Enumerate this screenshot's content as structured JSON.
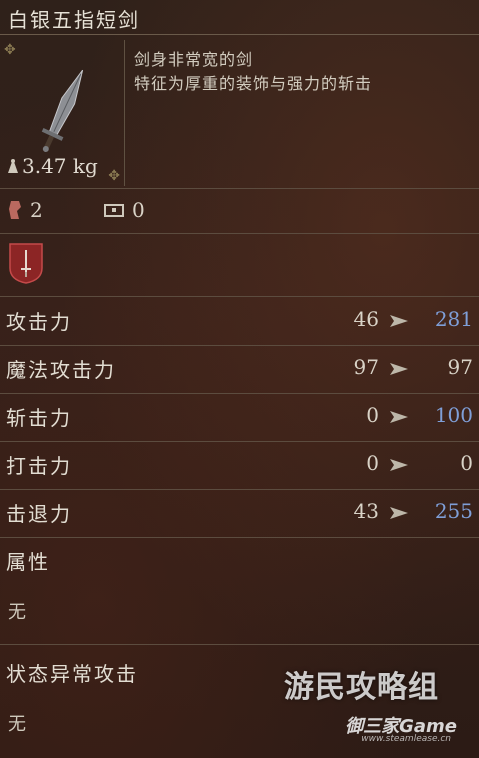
{
  "item": {
    "name": "白银五指短剑",
    "description_line1": "剑身非常宽的剑",
    "description_line2": "特征为厚重的装饰与强力的斩击",
    "weight": "3.47 kg",
    "requirement_strength": "2",
    "requirement_other": "0"
  },
  "stats": [
    {
      "label": "攻击力",
      "base": "46",
      "value": "281",
      "boosted": true
    },
    {
      "label": "魔法攻击力",
      "base": "97",
      "value": "97",
      "boosted": false
    },
    {
      "label": "斩击力",
      "base": "0",
      "value": "100",
      "boosted": true
    },
    {
      "label": "打击力",
      "base": "0",
      "value": "0",
      "boosted": false
    },
    {
      "label": "击退力",
      "base": "43",
      "value": "255",
      "boosted": true
    }
  ],
  "attribute": {
    "label": "属性",
    "value": "无"
  },
  "status_attack": {
    "label": "状态异常攻击",
    "value": "无"
  },
  "watermark": {
    "main": "游民攻略组",
    "site": "御三家Game",
    "url": "www.steamlease.cn"
  },
  "colors": {
    "boosted": "#7f9fd8",
    "normal": "#d9d3c7",
    "accent_badge": "#9b2a2a"
  },
  "icons": [
    "dagger-icon",
    "weight-icon",
    "strength-icon",
    "chest-icon",
    "weapon-class-icon",
    "arrow-icon"
  ]
}
